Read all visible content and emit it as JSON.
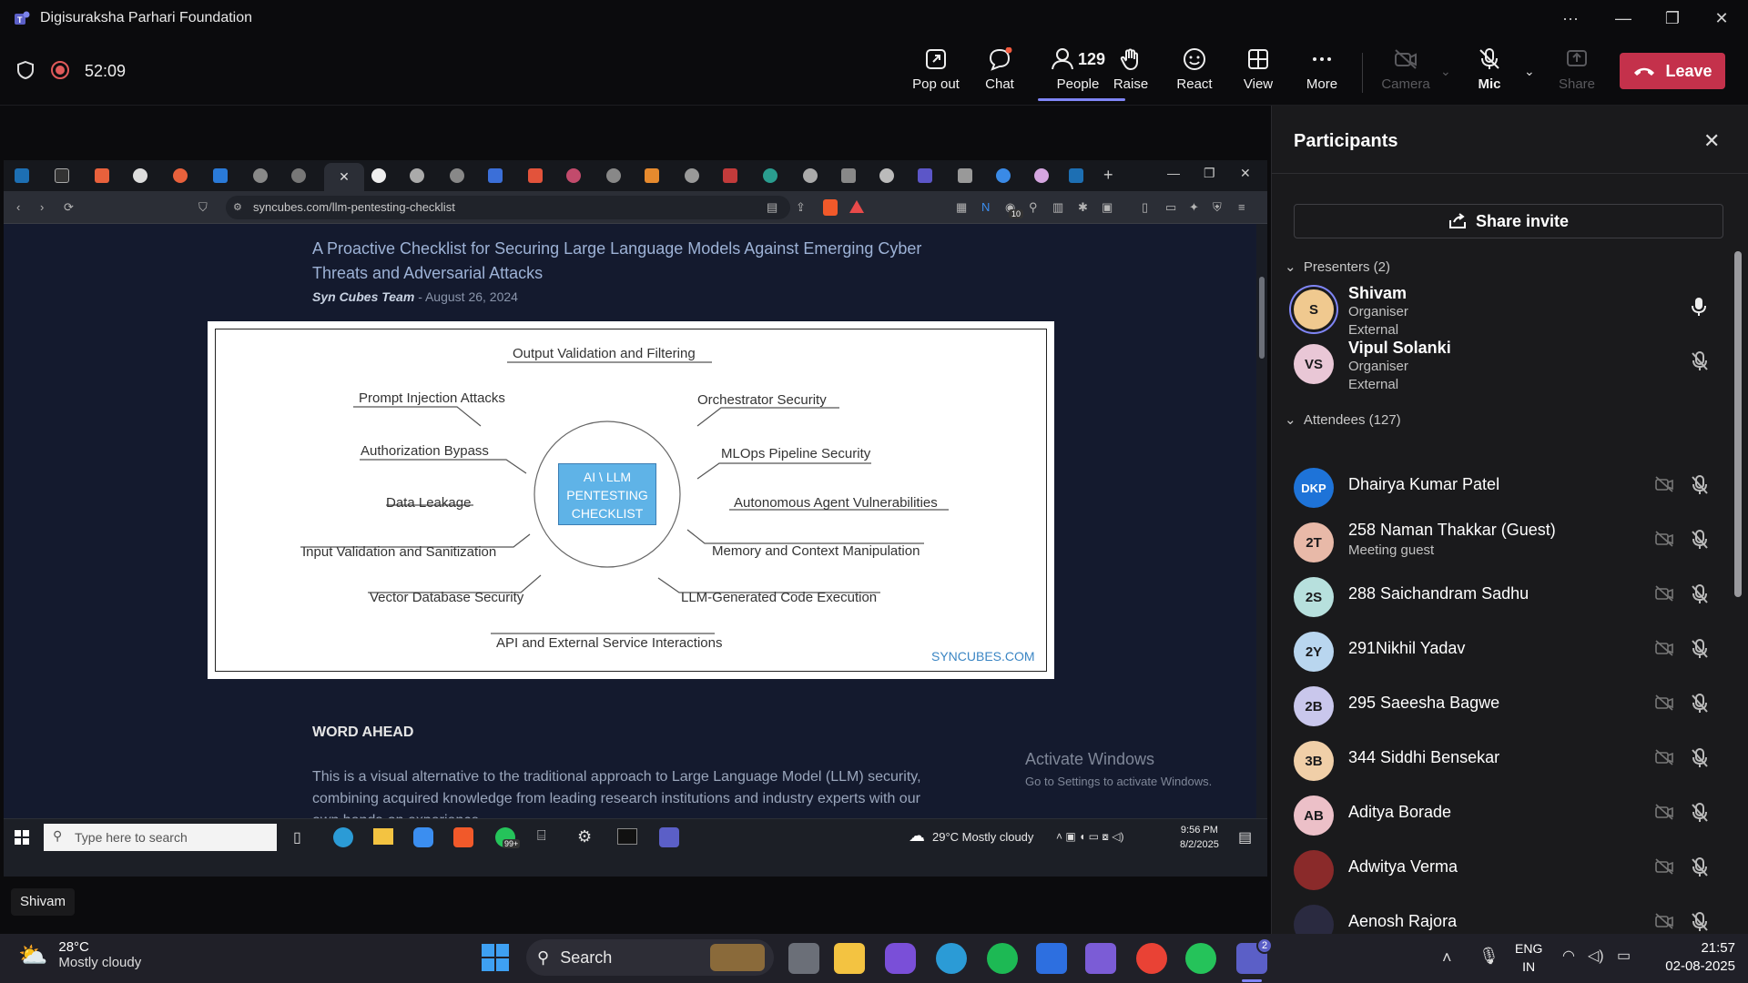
{
  "window": {
    "title": "Digisuraksha Parhari Foundation"
  },
  "meeting": {
    "timer": "52:09",
    "people_count": "129",
    "buttons": {
      "popout": "Pop out",
      "chat": "Chat",
      "people": "People",
      "raise": "Raise",
      "react": "React",
      "view": "View",
      "more": "More",
      "camera": "Camera",
      "mic": "Mic",
      "share": "Share",
      "leave": "Leave"
    }
  },
  "browser": {
    "url": "syncubes.com/llm-pentesting-checklist",
    "extension_badge": "10"
  },
  "article": {
    "heading": "A Proactive Checklist for Securing Large Language Models Against Emerging Cyber Threats and Adversarial Attacks",
    "author": "Syn Cubes Team",
    "date": "- August 26, 2024",
    "section": "WORD AHEAD",
    "paragraph": "This is a visual alternative to the traditional approach to Large Language Model (LLM) security, combining acquired knowledge from leading research institutions and industry experts with our own hands-on experience."
  },
  "diagram": {
    "center": [
      "AI \\ LLM",
      "PENTESTING",
      "CHECKLIST"
    ],
    "labels": {
      "output_validation": "Output Validation and Filtering",
      "prompt_injection": "Prompt Injection Attacks",
      "orchestrator": "Orchestrator Security",
      "authorization": "Authorization Bypass",
      "mlops": "MLOps Pipeline Security",
      "data_leakage": "Data Leakage",
      "autonomous": "Autonomous Agent Vulnerabilities",
      "input_validation": "Input Validation and Sanitization",
      "memory": "Memory and Context Manipulation",
      "vector_db": "Vector Database Security",
      "code_exec": "LLM-Generated Code Execution",
      "api": "API and External Service Interactions"
    },
    "brand": "SYNCUBES.COM"
  },
  "watermark": {
    "line1": "Activate Windows",
    "line2": "Go to Settings to activate Windows."
  },
  "inner_taskbar": {
    "search_placeholder": "Type here to search",
    "weather": "29°C  Mostly cloudy",
    "time": "9:56 PM",
    "date": "8/2/2025",
    "badge": "99+"
  },
  "presenter_label": "Shivam",
  "participants": {
    "title": "Participants",
    "share_invite": "Share invite",
    "presenters_header": "Presenters (2)",
    "attendees_header": "Attendees (127)",
    "presenters": [
      {
        "initials": "S",
        "name": "Shivam",
        "role": "Organiser",
        "ext": "External",
        "color": "#f0c98f"
      },
      {
        "initials": "VS",
        "name": "Vipul Solanki",
        "role": "Organiser",
        "ext": "External",
        "color": "#e9c7d6"
      }
    ],
    "attendees": [
      {
        "initials": "DKP",
        "name": "Dhairya Kumar Patel",
        "sub": "",
        "color": "#1e73d8"
      },
      {
        "initials": "2T",
        "name": "258 Naman Thakkar (Guest)",
        "sub": "Meeting guest",
        "color": "#e8b9a8"
      },
      {
        "initials": "2S",
        "name": "288 Saichandram Sadhu",
        "sub": "",
        "color": "#b7e0dd"
      },
      {
        "initials": "2Y",
        "name": "291Nikhil Yadav",
        "sub": "",
        "color": "#b9d6ef"
      },
      {
        "initials": "2B",
        "name": "295 Saeesha Bagwe",
        "sub": "",
        "color": "#c9c7ec"
      },
      {
        "initials": "3B",
        "name": "344 Siddhi Bensekar",
        "sub": "",
        "color": "#f0cfa8"
      },
      {
        "initials": "AB",
        "name": "Aditya Borade",
        "sub": "",
        "color": "#ecc0c8"
      },
      {
        "initials": "",
        "name": "Adwitya Verma",
        "sub": "",
        "color": "#8a2a2a"
      },
      {
        "initials": "",
        "name": "Aenosh Rajora",
        "sub": "",
        "color": "#2a2a40"
      }
    ]
  },
  "taskbar": {
    "weather_temp": "28°C",
    "weather_desc": "Mostly cloudy",
    "search": "Search",
    "lang1": "ENG",
    "lang2": "IN",
    "time": "21:57",
    "date": "02-08-2025",
    "teams_badge": "2"
  }
}
